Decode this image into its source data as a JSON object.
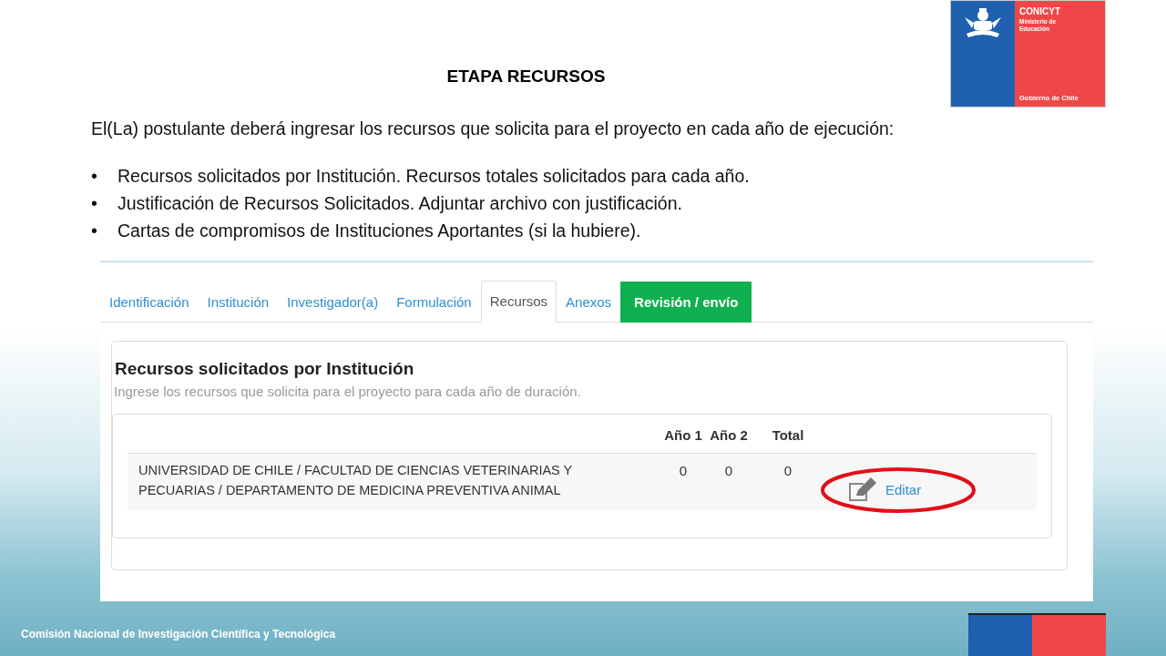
{
  "logo": {
    "name": "CONICYT",
    "lines": [
      "Ministerio de",
      "Educación"
    ],
    "footer": "Gobierno de Chile"
  },
  "slide": {
    "title": "ETAPA RECURSOS",
    "intro": "El(La) postulante deberá ingresar los recursos que solicita para el proyecto en cada año de ejecución:",
    "bullet_mark": "•",
    "bullets": [
      "Recursos solicitados por Institución. Recursos totales solicitados para cada año.",
      "Justificación de Recursos Solicitados. Adjuntar archivo con justificación.",
      "Cartas de compromisos de Instituciones Aportantes (si la hubiere)."
    ]
  },
  "screenshot": {
    "tabs": [
      {
        "label": "Identificación",
        "selected": false,
        "kind": "tab"
      },
      {
        "label": "Institución",
        "selected": false,
        "kind": "tab"
      },
      {
        "label": "Investigador(a)",
        "selected": false,
        "kind": "tab"
      },
      {
        "label": "Formulación",
        "selected": false,
        "kind": "tab"
      },
      {
        "label": "Recursos",
        "selected": true,
        "kind": "tab"
      },
      {
        "label": "Anexos",
        "selected": false,
        "kind": "tab"
      },
      {
        "label": "Revisión / envío",
        "selected": false,
        "kind": "action"
      }
    ],
    "panel": {
      "title": "Recursos solicitados por Institución",
      "subtitle": "Ingrese los recursos que solicita para el proyecto para cada año de duración.",
      "columns": [
        "Año 1",
        "Año 2",
        "Total"
      ],
      "rows": [
        {
          "institution": "UNIVERSIDAD DE CHILE / FACULTAD DE CIENCIAS VETERINARIAS Y PECUARIAS / DEPARTAMENTO DE MEDICINA PREVENTIVA ANIMAL",
          "values": [
            "0",
            "0",
            "0"
          ],
          "action": "Editar",
          "highlighted": true
        }
      ]
    }
  },
  "footer": "Comisión Nacional de Investigación Científica y Tecnológica"
}
